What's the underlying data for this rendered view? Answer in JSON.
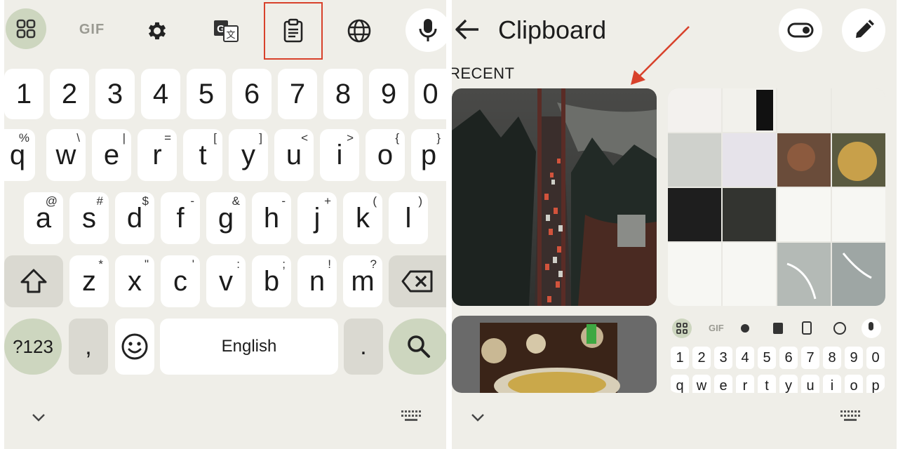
{
  "keyboard": {
    "toolbar": {
      "grid": "apps-grid-icon",
      "gif": "GIF",
      "settings": "gear-icon",
      "translate": "translate-icon",
      "clipboard": "clipboard-icon",
      "language": "globe-icon",
      "voice": "mic-icon"
    },
    "number_row": [
      "1",
      "2",
      "3",
      "4",
      "5",
      "6",
      "7",
      "8",
      "9",
      "0"
    ],
    "row1": [
      {
        "k": "q",
        "h": "%"
      },
      {
        "k": "w",
        "h": "\\"
      },
      {
        "k": "e",
        "h": "|"
      },
      {
        "k": "r",
        "h": "="
      },
      {
        "k": "t",
        "h": "["
      },
      {
        "k": "y",
        "h": "]"
      },
      {
        "k": "u",
        "h": "<"
      },
      {
        "k": "i",
        "h": ">"
      },
      {
        "k": "o",
        "h": "{"
      },
      {
        "k": "p",
        "h": "}"
      }
    ],
    "row2": [
      {
        "k": "a",
        "h": "@"
      },
      {
        "k": "s",
        "h": "#"
      },
      {
        "k": "d",
        "h": "$"
      },
      {
        "k": "f",
        "h": "-"
      },
      {
        "k": "g",
        "h": "&"
      },
      {
        "k": "h",
        "h": "-"
      },
      {
        "k": "j",
        "h": "+"
      },
      {
        "k": "k",
        "h": "("
      },
      {
        "k": "l",
        "h": ")"
      }
    ],
    "row3": [
      {
        "k": "z",
        "h": "*"
      },
      {
        "k": "x",
        "h": "\""
      },
      {
        "k": "c",
        "h": "'"
      },
      {
        "k": "v",
        "h": ":"
      },
      {
        "k": "b",
        "h": ";"
      },
      {
        "k": "n",
        "h": "!"
      },
      {
        "k": "m",
        "h": "?"
      }
    ],
    "bottom": {
      "symbols": "?123",
      "comma": ",",
      "space": "English",
      "period": "."
    }
  },
  "clipboard": {
    "title": "Clipboard",
    "section": "RECENT",
    "mini_toolbar": [
      "GIF"
    ],
    "mini_numbers": [
      "1",
      "2",
      "3",
      "4",
      "5",
      "6",
      "7",
      "8",
      "9",
      "0"
    ],
    "mini_letters": [
      "q",
      "w",
      "e",
      "r",
      "t",
      "y",
      "u",
      "i",
      "o",
      "p"
    ]
  },
  "colors": {
    "accent_highlight": "#d8412b",
    "pill": "#cdd6bf",
    "background": "#efeee8"
  }
}
